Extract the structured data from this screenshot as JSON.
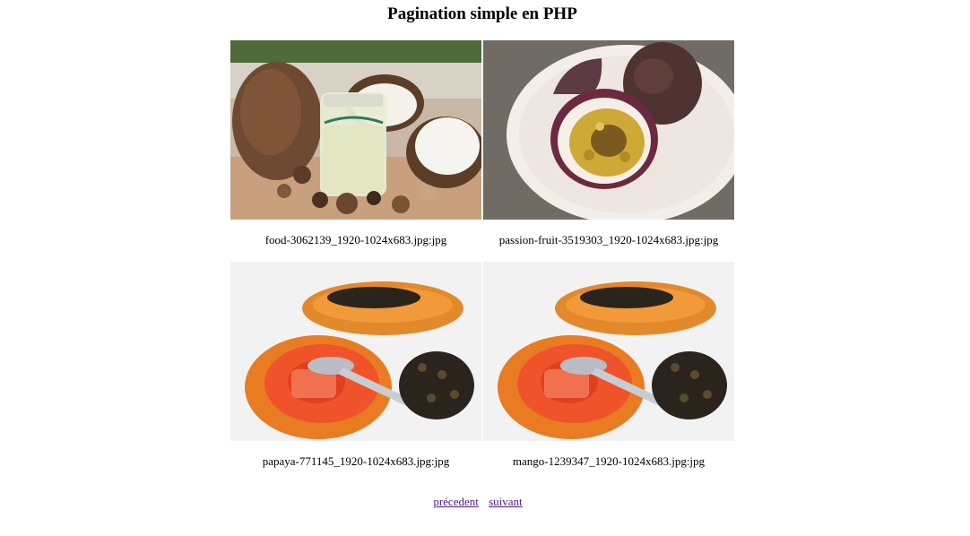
{
  "page": {
    "title": "Pagination simple en PHP"
  },
  "gallery": {
    "items": [
      {
        "caption": "food-3062139_1920-1024x683.jpg:jpg",
        "image": "coconut-photo"
      },
      {
        "caption": "passion-fruit-3519303_1920-1024x683.jpg:jpg",
        "image": "passion-fruit-photo"
      },
      {
        "caption": "papaya-771145_1920-1024x683.jpg:jpg",
        "image": "papaya-photo"
      },
      {
        "caption": "mango-1239347_1920-1024x683.jpg:jpg",
        "image": "papaya-photo"
      }
    ]
  },
  "pagination": {
    "prev_label": "précedent",
    "next_label": "suivant"
  }
}
